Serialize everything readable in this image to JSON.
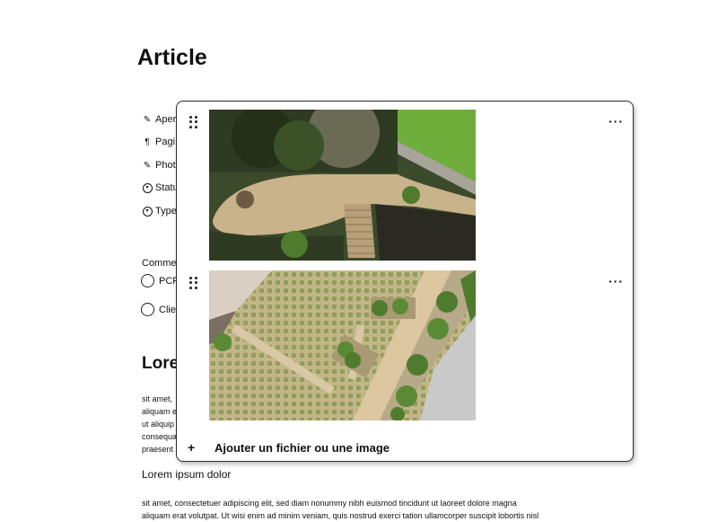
{
  "page": {
    "title": "Article"
  },
  "properties": [
    {
      "icon": "pencil-icon",
      "glyph": "✎",
      "label": "Aper"
    },
    {
      "icon": "paragraph-icon",
      "glyph": "¶",
      "label": "Pagi"
    },
    {
      "icon": "pencil-icon",
      "glyph": "✎",
      "label": "Phot"
    },
    {
      "icon": "chevron-circle-icon",
      "glyph": "▾",
      "label": "Statu"
    },
    {
      "icon": "chevron-circle-icon",
      "glyph": "▾",
      "label": "Type"
    }
  ],
  "comments": {
    "label": "Comme",
    "options": [
      {
        "label": "PCR"
      },
      {
        "label": "Clie"
      }
    ]
  },
  "content": {
    "heading": "Lore",
    "para1": [
      "sit amet,",
      "aliquam e",
      "ut aliquip",
      "consequa",
      "praesent"
    ],
    "subheading": "Lorem ipsum dolor",
    "para2": [
      "sit amet, consectetuer adipiscing elit, sed diam nonummy nibh euismod tincidunt ut laoreet dolore magna",
      "aliquam erat volutpat. Ut wisi enim ad minim veniam, quis nostrud exerci tation ullamcorper suscipit lobortis nisl"
    ]
  },
  "gallery": {
    "more_label": "···",
    "add_label": "Ajouter un fichier ou une image",
    "add_glyph": "+",
    "images": [
      {
        "name": "garden-aerial-image"
      },
      {
        "name": "courtyard-aerial-image"
      }
    ]
  }
}
